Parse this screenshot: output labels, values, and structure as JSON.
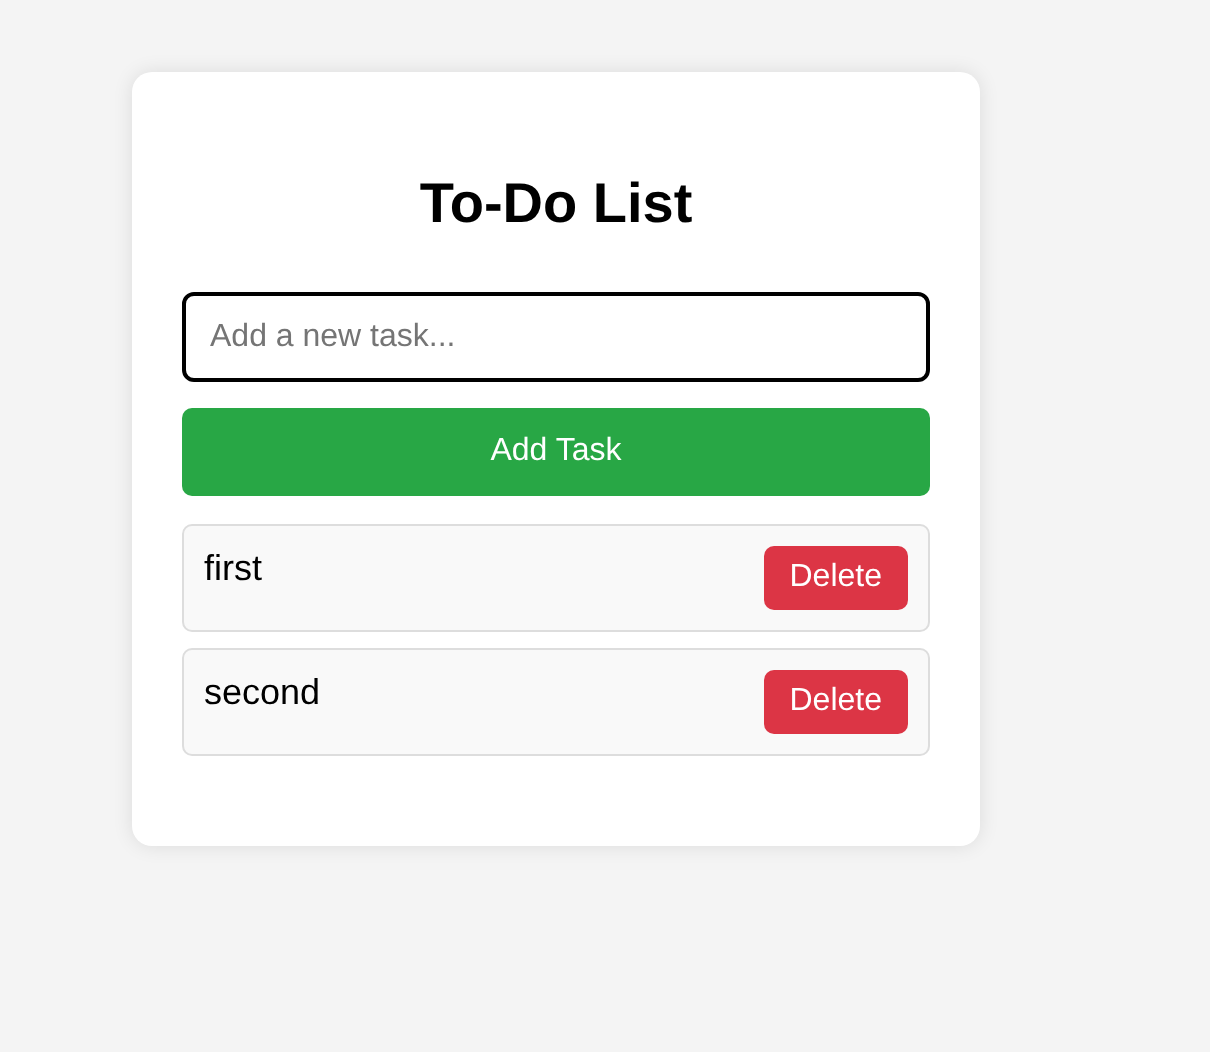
{
  "title": "To-Do List",
  "input": {
    "placeholder": "Add a new task..."
  },
  "add_button": "Add Task",
  "tasks": [
    {
      "text": "first",
      "delete_label": "Delete"
    },
    {
      "text": "second",
      "delete_label": "Delete"
    }
  ]
}
